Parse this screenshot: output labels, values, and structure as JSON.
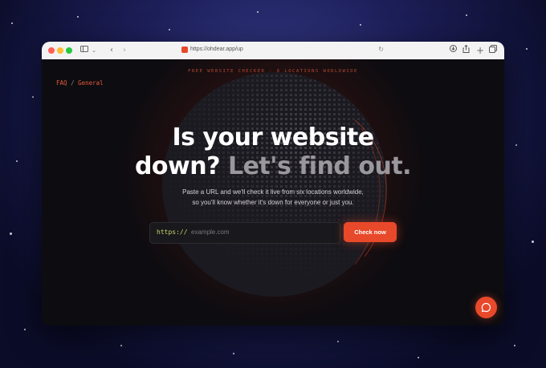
{
  "browser": {
    "url": "https://ohdear.app/up"
  },
  "breadcrumb": {
    "faq": "FAQ",
    "separator": "/",
    "general": "General"
  },
  "hero": {
    "eyebrow": "FREE WEBSITE CHECKER · 6 LOCATIONS WORLDWIDE",
    "headline_line1": "Is your website",
    "headline_line2_bright": "down?",
    "headline_line2_muted": "Let's find out.",
    "sub_line1": "Paste a URL and we'll check it live from six locations worldwide,",
    "sub_line2": "so you'll know whether it's down for everyone or just you."
  },
  "form": {
    "prefix": "https://",
    "placeholder": "example.com",
    "button_label": "Check now"
  },
  "colors": {
    "accent": "#e8492a",
    "prefix": "#cbd56e",
    "background": "#0d0c10"
  },
  "icons": {
    "sidebar": "sidebar-icon",
    "chat": "chat-icon",
    "download": "download-icon",
    "share": "share-icon",
    "new_tab": "plus-icon",
    "tabs": "tabs-icon"
  }
}
